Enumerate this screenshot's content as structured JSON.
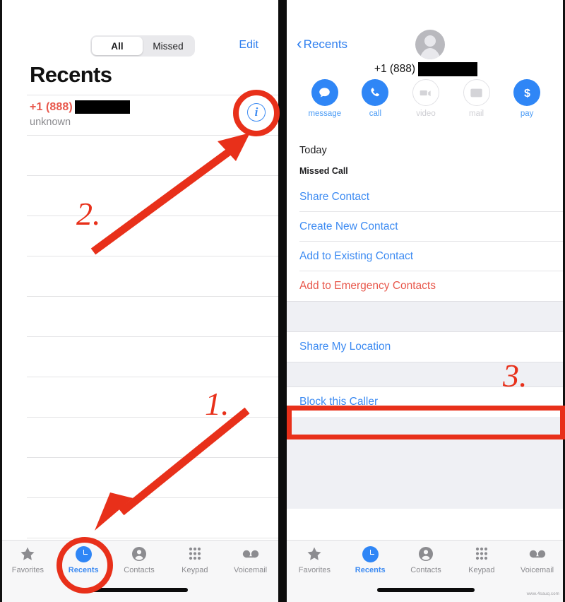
{
  "left_panel": {
    "segmented": {
      "options": [
        "All",
        "Missed"
      ],
      "selected": "All"
    },
    "edit_label": "Edit",
    "title": "Recents",
    "call_entry": {
      "number_prefix": "+1 (888)",
      "number_redacted": true,
      "subtitle": "unknown",
      "info_icon": "info-circle-icon"
    },
    "tabbar": {
      "tabs": [
        {
          "label": "Favorites",
          "icon": "star-icon",
          "active": false
        },
        {
          "label": "Recents",
          "icon": "clock-icon",
          "active": true
        },
        {
          "label": "Contacts",
          "icon": "person-circle-icon",
          "active": false
        },
        {
          "label": "Keypad",
          "icon": "keypad-dots-icon",
          "active": false
        },
        {
          "label": "Voicemail",
          "icon": "voicemail-icon",
          "active": false
        }
      ]
    }
  },
  "right_panel": {
    "back_label": "Recents",
    "avatar": "default-avatar-icon",
    "detail_number_prefix": "+1 (888)",
    "actions": [
      {
        "label": "message",
        "icon": "message-bubble-icon",
        "enabled": true
      },
      {
        "label": "call",
        "icon": "phone-icon",
        "enabled": true
      },
      {
        "label": "video",
        "icon": "video-camera-icon",
        "enabled": false
      },
      {
        "label": "mail",
        "icon": "envelope-icon",
        "enabled": false
      },
      {
        "label": "pay",
        "icon": "dollar-sign-icon",
        "enabled": true
      }
    ],
    "today_label": "Today",
    "missed_call_label": "Missed Call",
    "group_one": [
      {
        "label": "Share Contact",
        "style": "link"
      },
      {
        "label": "Create New Contact",
        "style": "link"
      },
      {
        "label": "Add to Existing Contact",
        "style": "link"
      },
      {
        "label": "Add to Emergency Contacts",
        "style": "danger"
      }
    ],
    "group_two": [
      {
        "label": "Share My Location",
        "style": "link"
      }
    ],
    "group_three": [
      {
        "label": "Block this Caller",
        "style": "link"
      }
    ],
    "tabbar": {
      "tabs": [
        {
          "label": "Favorites",
          "icon": "star-icon",
          "active": false
        },
        {
          "label": "Recents",
          "icon": "clock-icon",
          "active": true
        },
        {
          "label": "Contacts",
          "icon": "person-circle-icon",
          "active": false
        },
        {
          "label": "Keypad",
          "icon": "keypad-dots-icon",
          "active": false
        },
        {
          "label": "Voicemail",
          "icon": "voicemail-icon",
          "active": false
        }
      ]
    }
  },
  "annotations": {
    "step_one": "1.",
    "step_two": "2.",
    "step_three": "3.",
    "color": "#e8301a"
  },
  "watermark": "www.4sauq.com"
}
